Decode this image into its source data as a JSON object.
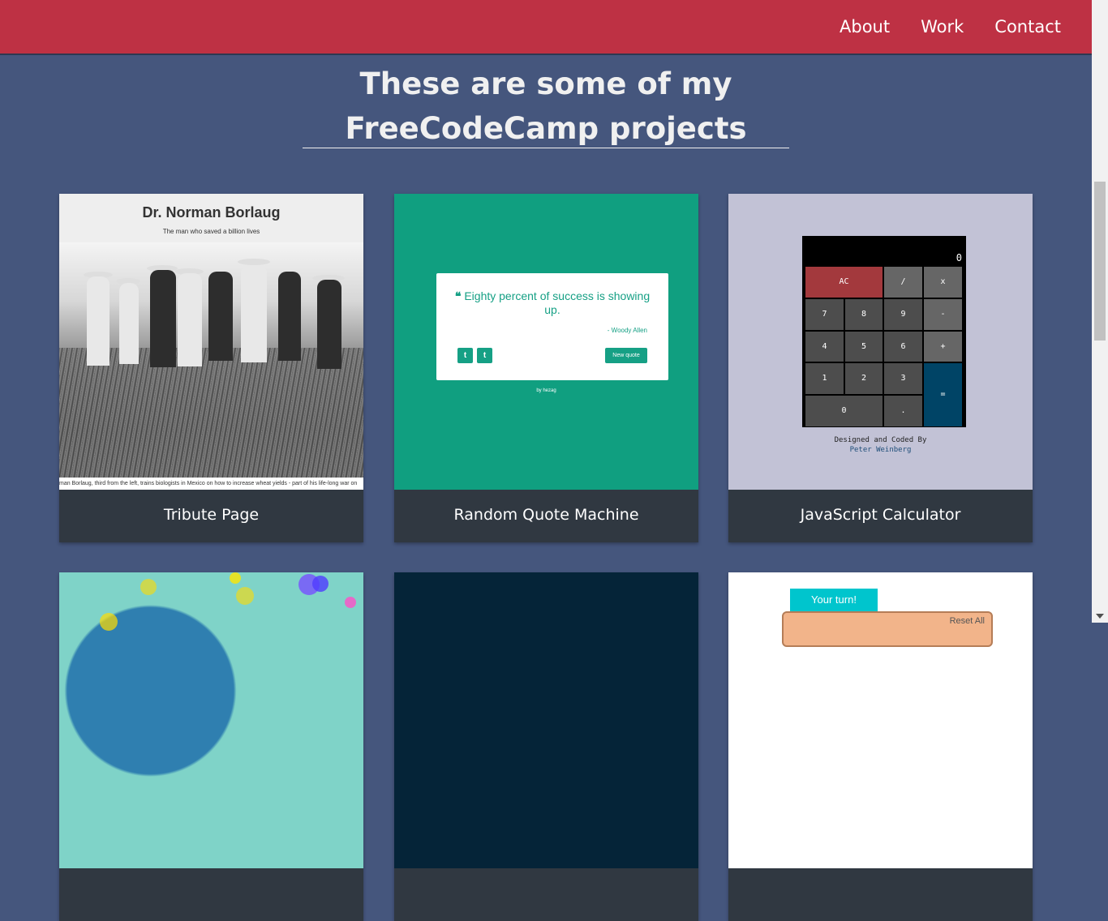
{
  "nav": {
    "links": [
      "About",
      "Work",
      "Contact"
    ]
  },
  "header": {
    "title_line1": "These are some of my",
    "title_line2": "FreeCodeCamp projects"
  },
  "projects": [
    {
      "caption": "Tribute Page",
      "preview": {
        "title": "Dr. Norman Borlaug",
        "subtitle": "The man who saved a billion lives",
        "photo_caption": "man Borlaug, third from the left, trains biologists in Mexico on how to increase wheat yields - part of his life-long war on"
      }
    },
    {
      "caption": "Random Quote Machine",
      "preview": {
        "quote": "Eighty percent of success is showing up.",
        "author": "- Woody Allen",
        "new_quote_button": "New quote",
        "twitter_icon": "t",
        "tumblr_icon": "t",
        "by_line": "by hezag"
      }
    },
    {
      "caption": "JavaScript Calculator",
      "preview": {
        "display": "0",
        "keys": [
          "AC",
          "/",
          "x",
          "7",
          "8",
          "9",
          "-",
          "4",
          "5",
          "6",
          "+",
          "1",
          "2",
          "3",
          "=",
          "0",
          "."
        ],
        "credit_line1": "Designed and Coded By",
        "credit_line2": "Peter Weinberg"
      }
    },
    {
      "caption": "",
      "preview": {}
    },
    {
      "caption": "",
      "preview": {}
    },
    {
      "caption": "",
      "preview": {
        "turn_label": "Your turn!",
        "reset_label": "Reset All"
      }
    }
  ],
  "colors": {
    "nav_bg": "#be3144",
    "page_bg": "#45567d",
    "tile_caption_bg": "#303841",
    "quote_green": "#16a085"
  }
}
